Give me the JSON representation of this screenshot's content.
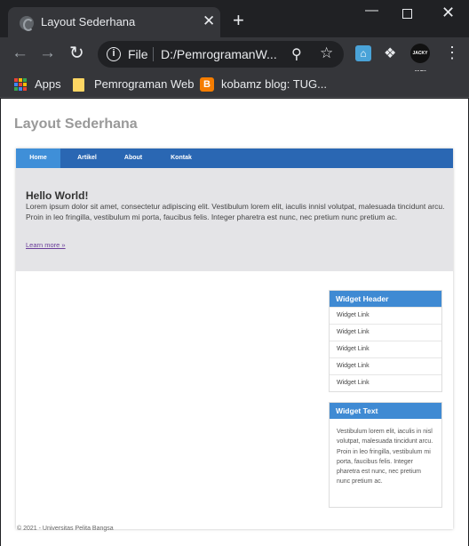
{
  "browser": {
    "tab_title": "Layout Sederhana",
    "tab_close": "✕",
    "new_tab": "+",
    "window_min": "—",
    "window_close": "✕",
    "scheme": "File",
    "url": "D:/PemrogramanW...",
    "avatar_text": "JACKY JACK",
    "bookmarks": {
      "apps": "Apps",
      "folder": "Pemrograman Web",
      "blogger": "kobamz blog: TUG...",
      "blogger_icon_letter": "B"
    }
  },
  "page": {
    "title": "Layout Sederhana",
    "nav": [
      "Home",
      "Artikel",
      "About",
      "Kontak"
    ],
    "hero": {
      "title": "Hello World!",
      "text": "Lorem ipsum dolor sit amet, consectetur adipiscing elit. Vestibulum lorem elit, iaculis innisl volutpat, malesuada tincidunt arcu. Proin in leo fringilla, vestibulum mi porta, faucibus felis. Integer pharetra est nunc, nec pretium nunc pretium ac.",
      "link": "Learn more »"
    },
    "widget_links": {
      "header": "Widget Header",
      "items": [
        "Widget Link",
        "Widget Link",
        "Widget Link",
        "Widget Link",
        "Widget Link"
      ]
    },
    "widget_text": {
      "header": "Widget Text",
      "body": "Vestibulum lorem elit, iaculis in nisl volutpat, malesuada tincidunt arcu. Proin in leo fringilla, vestibulum mi porta, faucibus felis. Integer pharetra est nunc, nec pretium nunc pretium ac."
    },
    "footer": "© 2021 - Universitas Pelita Bangsa"
  },
  "colors": {
    "nav_bar": "#2a67b3",
    "nav_active": "#3f8fd8",
    "widget_header": "#3f8ad3",
    "hero_bg": "#e4e4e7",
    "browser_frame": "#202124",
    "browser_toolbar": "#35363a"
  },
  "icons": {
    "tab_favicon": "globe-icon",
    "back": "arrow-left-icon",
    "forward": "arrow-right-icon",
    "reload": "reload-icon",
    "site_info": "info-icon",
    "zoom": "zoom-icon",
    "bookmark": "star-icon",
    "extension_home": "home-icon",
    "extensions": "puzzle-icon",
    "menu": "kebab-menu-icon",
    "apps": "apps-grid-icon",
    "folder": "folder-icon",
    "blogger": "blogger-icon"
  }
}
